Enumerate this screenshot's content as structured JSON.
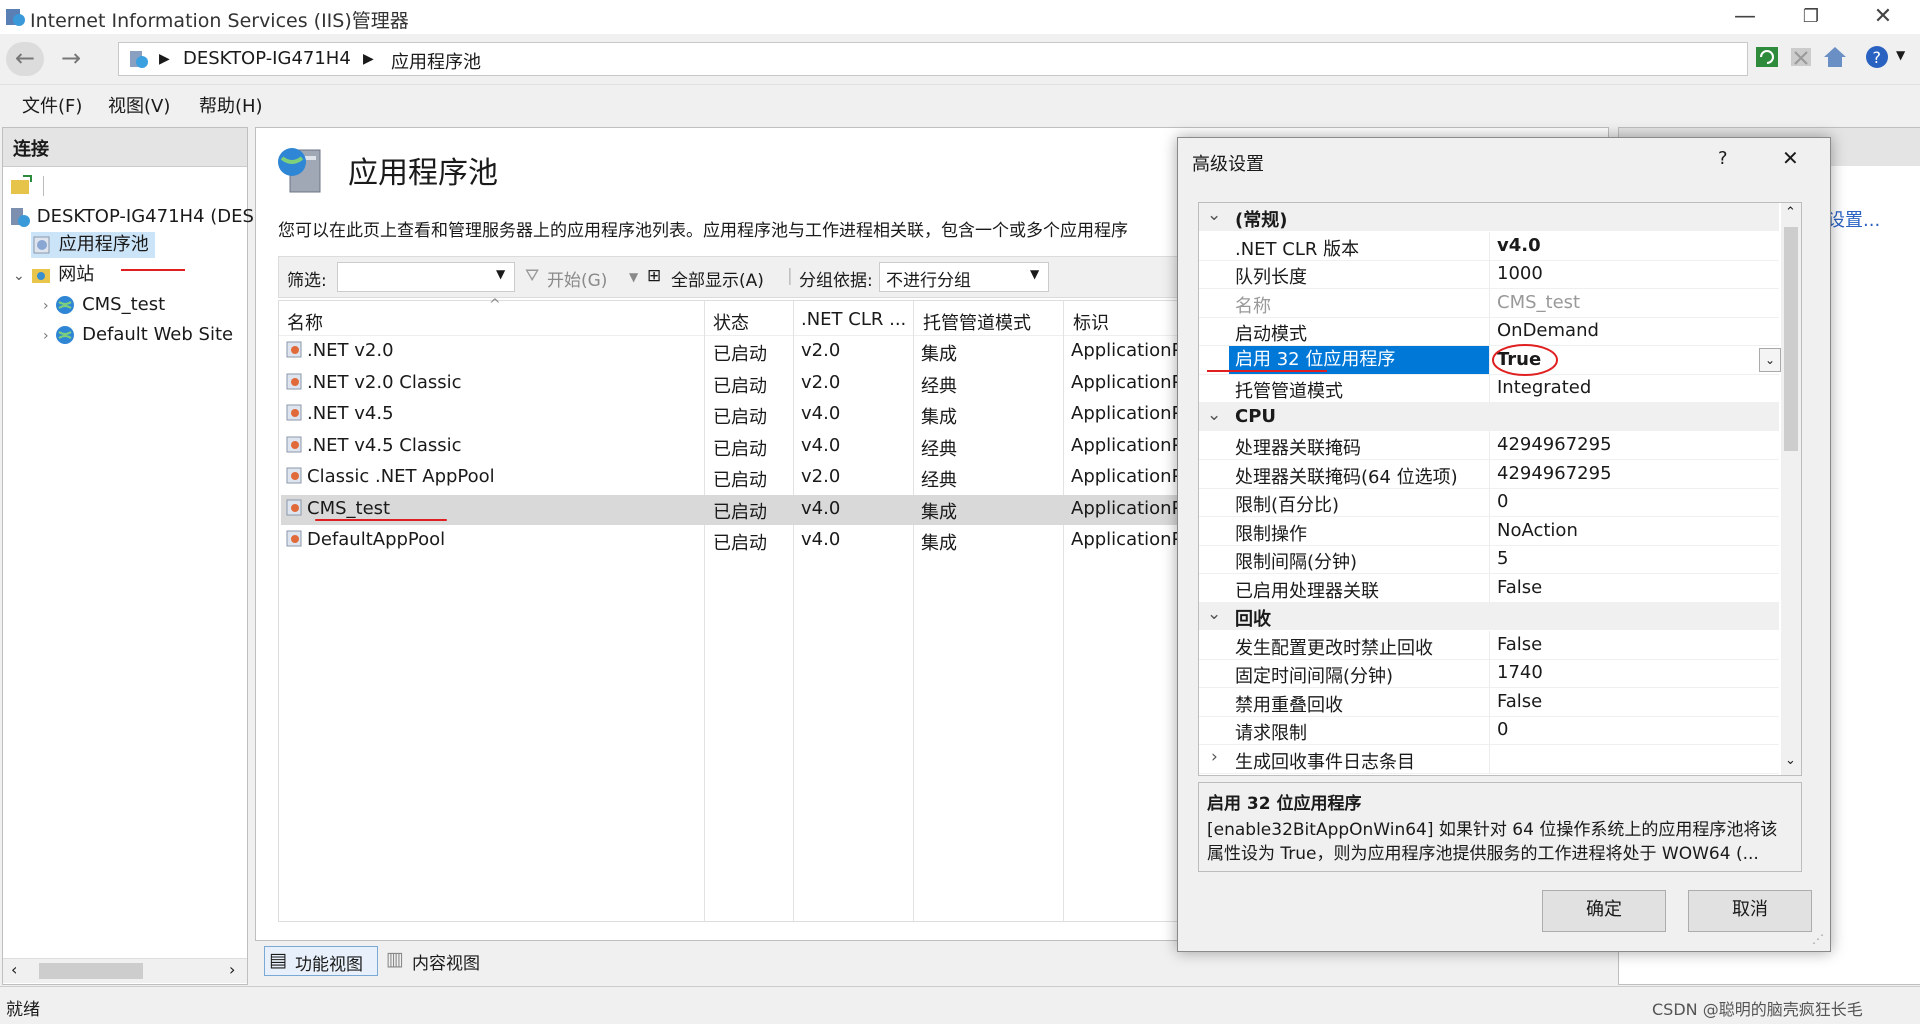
{
  "window": {
    "title": "Internet Information Services (IIS)管理器"
  },
  "address": {
    "segments": [
      "DESKTOP-IG471H4",
      "应用程序池"
    ]
  },
  "menu": {
    "file": "文件(F)",
    "view": "视图(V)",
    "help": "帮助(H)"
  },
  "connections": {
    "title": "连接",
    "tree": {
      "server": "DESKTOP-IG471H4 (DES",
      "app_pools": "应用程序池",
      "sites": "网站",
      "site1": "CMS_test",
      "site2": "Default Web Site"
    }
  },
  "center": {
    "title": "应用程序池",
    "description": "您可以在此页上查看和管理服务器上的应用程序池列表。应用程序池与工作进程相关联，包含一个或多个应用程序",
    "filter": {
      "label": "筛选:",
      "start": "开始(G)",
      "show_all": "全部显示(A)",
      "group_by": "分组依据:",
      "group_value": "不进行分组"
    },
    "columns": [
      "名称",
      "状态",
      ".NET CLR ...",
      "托管管道模式",
      "标识"
    ],
    "rows": [
      {
        "name": ".NET v2.0",
        "status": "已启动",
        "clr": "v2.0",
        "mode": "集成",
        "identity": "ApplicationP"
      },
      {
        "name": ".NET v2.0 Classic",
        "status": "已启动",
        "clr": "v2.0",
        "mode": "经典",
        "identity": "ApplicationP"
      },
      {
        "name": ".NET v4.5",
        "status": "已启动",
        "clr": "v4.0",
        "mode": "集成",
        "identity": "ApplicationP"
      },
      {
        "name": ".NET v4.5 Classic",
        "status": "已启动",
        "clr": "v4.0",
        "mode": "经典",
        "identity": "ApplicationP"
      },
      {
        "name": "Classic .NET AppPool",
        "status": "已启动",
        "clr": "v2.0",
        "mode": "经典",
        "identity": "ApplicationP"
      },
      {
        "name": "CMS_test",
        "status": "已启动",
        "clr": "v4.0",
        "mode": "集成",
        "identity": "ApplicationP"
      },
      {
        "name": "DefaultAppPool",
        "status": "已启动",
        "clr": "v4.0",
        "mode": "集成",
        "identity": "ApplicationP"
      }
    ],
    "tabs": {
      "features": "功能视图",
      "content": "内容视图"
    }
  },
  "actions": {
    "link": "设置..."
  },
  "status": {
    "text": "就绪",
    "watermark": "CSDN @聪明的脑壳疯狂长毛"
  },
  "dialog": {
    "title": "高级设置",
    "help": "?",
    "groups": [
      {
        "name": "(常规)",
        "props": [
          {
            "name": ".NET CLR 版本",
            "value": "v4.0",
            "bold": true
          },
          {
            "name": "队列长度",
            "value": "1000"
          },
          {
            "name": "名称",
            "value": "CMS_test",
            "disabled": true
          },
          {
            "name": "启动模式",
            "value": "OnDemand"
          },
          {
            "name": "启用 32 位应用程序",
            "value": "True",
            "selected": true,
            "bold": true
          },
          {
            "name": "托管管道模式",
            "value": "Integrated"
          }
        ]
      },
      {
        "name": "CPU",
        "props": [
          {
            "name": "处理器关联掩码",
            "value": "4294967295"
          },
          {
            "name": "处理器关联掩码(64 位选项)",
            "value": "4294967295"
          },
          {
            "name": "限制(百分比)",
            "value": "0"
          },
          {
            "name": "限制操作",
            "value": "NoAction"
          },
          {
            "name": "限制间隔(分钟)",
            "value": "5"
          },
          {
            "name": "已启用处理器关联",
            "value": "False"
          }
        ]
      },
      {
        "name": "回收",
        "props": [
          {
            "name": "发生配置更改时禁止回收",
            "value": "False"
          },
          {
            "name": "固定时间间隔(分钟)",
            "value": "1740"
          },
          {
            "name": "禁用重叠回收",
            "value": "False"
          },
          {
            "name": "请求限制",
            "value": "0"
          },
          {
            "name": "生成回收事件日志条目",
            "value": "",
            "collapsed": true
          }
        ]
      }
    ],
    "desc": {
      "title": "启用 32 位应用程序",
      "line1": "[enable32BitAppOnWin64] 如果针对 64 位操作系统上的应用程序池将该",
      "line2": "属性设为 True，则为应用程序池提供服务的工作进程将处于 WOW64 (..."
    },
    "ok": "确定",
    "cancel": "取消"
  },
  "colors": {
    "selection": "#0078d7",
    "annotation": "#e02020"
  }
}
